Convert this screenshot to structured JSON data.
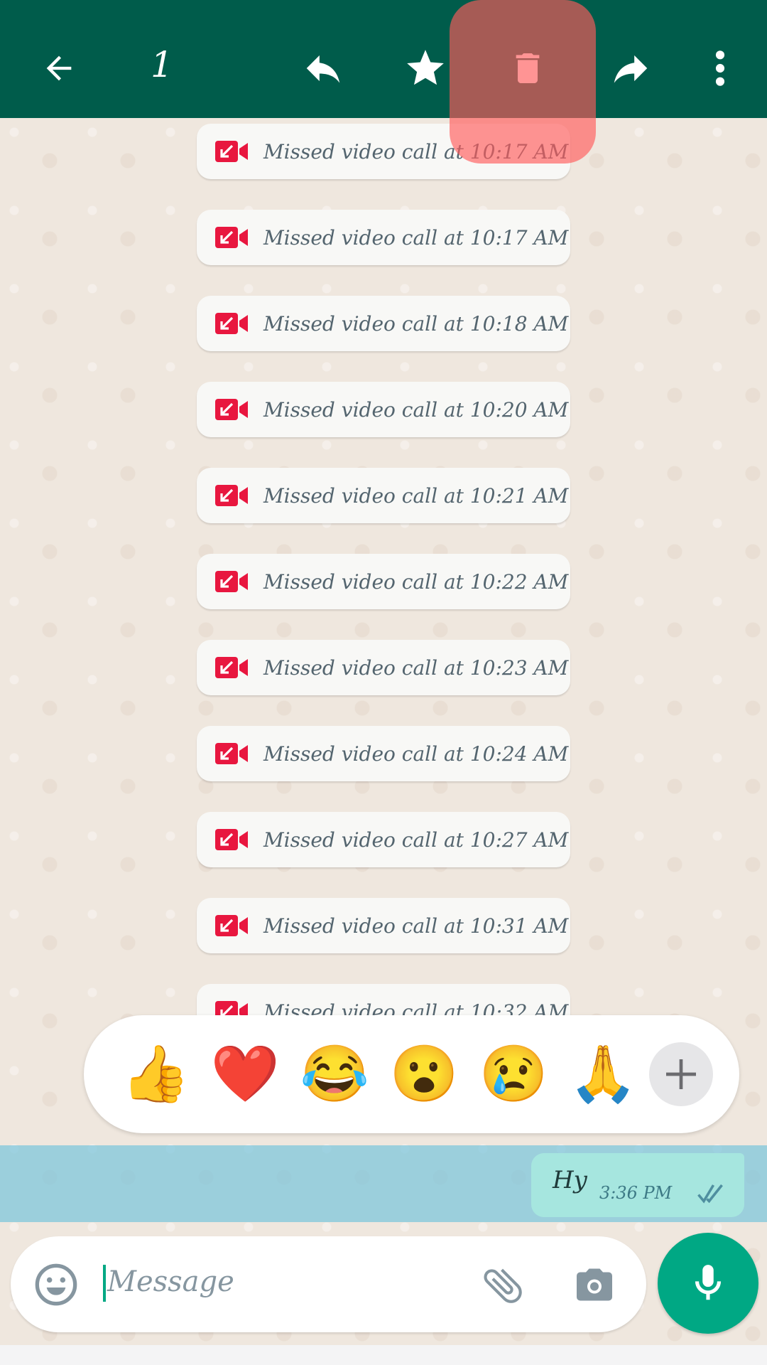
{
  "header": {
    "selected_count": "1",
    "icons": [
      "back-arrow-icon",
      "reply-icon",
      "star-icon",
      "delete-icon",
      "forward-icon",
      "more-options-icon"
    ],
    "bg_color": "#005c4b"
  },
  "messages": [
    {
      "text": "Missed video call at 10:17 AM"
    },
    {
      "text": "Missed video call at 10:17 AM"
    },
    {
      "text": "Missed video call at 10:18 AM"
    },
    {
      "text": "Missed video call at 10:20 AM"
    },
    {
      "text": "Missed video call at 10:21 AM"
    },
    {
      "text": "Missed video call at 10:22 AM"
    },
    {
      "text": "Missed video call at 10:23 AM"
    },
    {
      "text": "Missed video call at 10:24 AM"
    },
    {
      "text": "Missed video call at 10:27 AM"
    },
    {
      "text": "Missed video call at 10:31 AM"
    },
    {
      "text": "Missed video call at 10:32 AM"
    }
  ],
  "reactions": [
    "👍",
    "❤️",
    "😂",
    "😮",
    "😢",
    "🙏"
  ],
  "selected_message": {
    "text": "Hy",
    "time": "3:36 PM",
    "status": "read"
  },
  "composer": {
    "placeholder": "Message"
  },
  "colors": {
    "accent": "#00a884",
    "missed_call": "#e8173f",
    "highlight": "#ff5a5a"
  }
}
